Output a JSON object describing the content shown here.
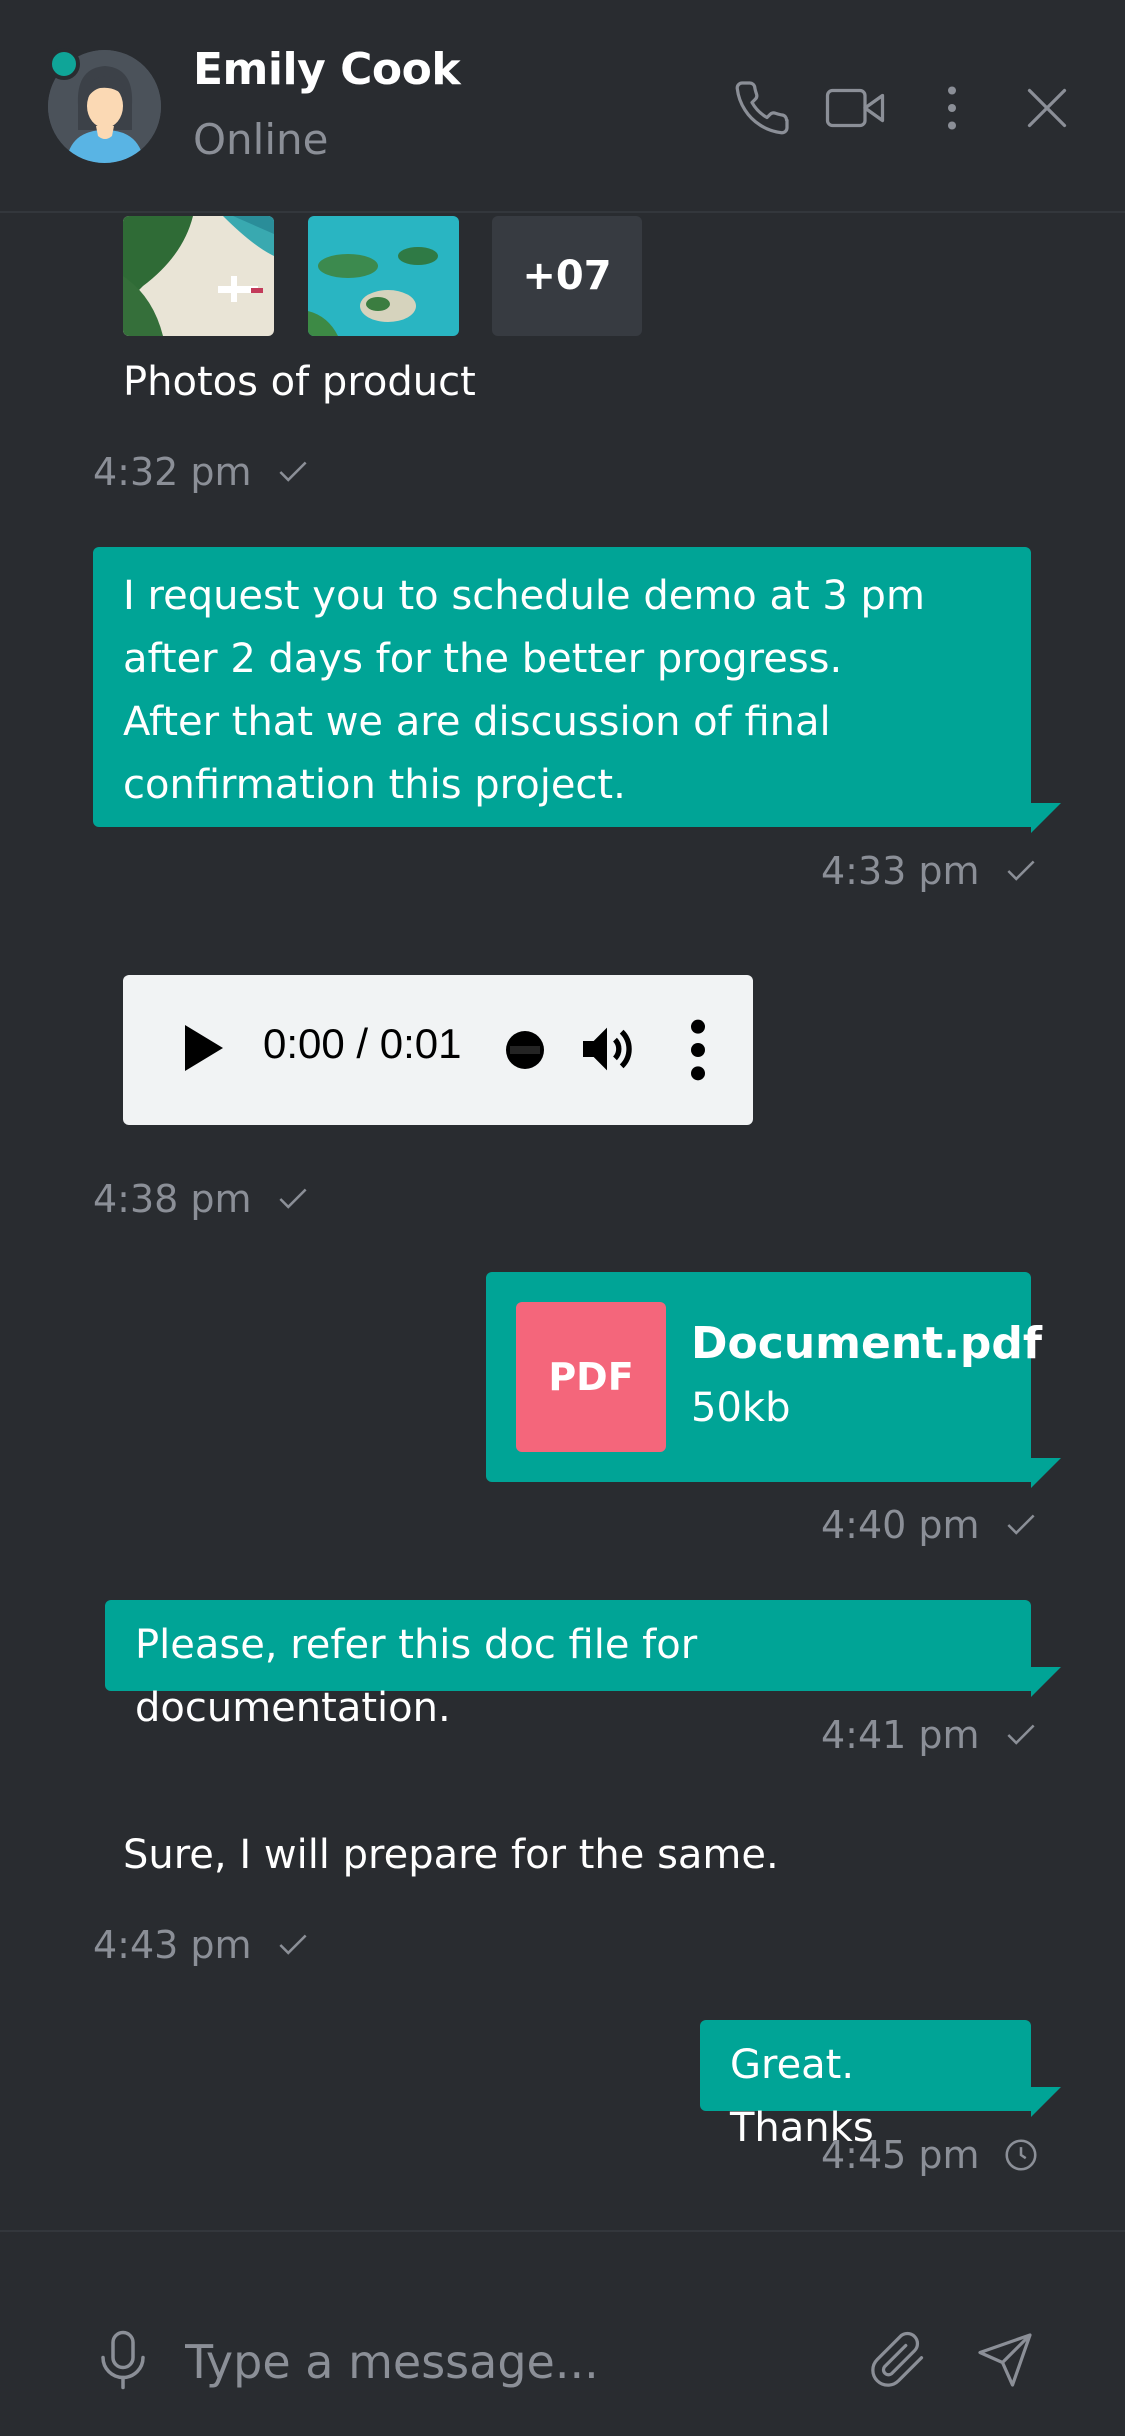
{
  "header": {
    "name": "Emily Cook",
    "status": "Online"
  },
  "gallery": {
    "more_label": "+07",
    "caption": "Photos of product",
    "time": "4:32 pm"
  },
  "msg_demo": {
    "text": "I request you to schedule demo at 3 pm\nafter 2 days for the better progress.\nAfter that we are discussion of final\nconfirmation this project.",
    "time": "4:33 pm"
  },
  "audio": {
    "time": "0:00 / 0:01",
    "sent_time": "4:38 pm"
  },
  "doc": {
    "type_label": "PDF",
    "name": "Document.pdf",
    "size": "50kb",
    "time": "4:40 pm"
  },
  "msg_refer": {
    "text": "Please, refer this doc file for documentation.",
    "time": "4:41 pm"
  },
  "msg_sure": {
    "text": "Sure, I will prepare for the same.",
    "time": "4:43 pm"
  },
  "msg_thanks": {
    "text": "Great. Thanks",
    "time": "4:45 pm"
  },
  "composer": {
    "placeholder": "Type a message..."
  },
  "colors": {
    "background": "#292c30",
    "accent": "#00a496",
    "muted_text": "#8b8f97",
    "pdf": "#f4667b"
  },
  "icons": [
    "phone-icon",
    "video-icon",
    "more-vertical-icon",
    "close-icon",
    "check-icon",
    "clock-icon",
    "mic-icon",
    "paperclip-icon",
    "send-icon"
  ]
}
